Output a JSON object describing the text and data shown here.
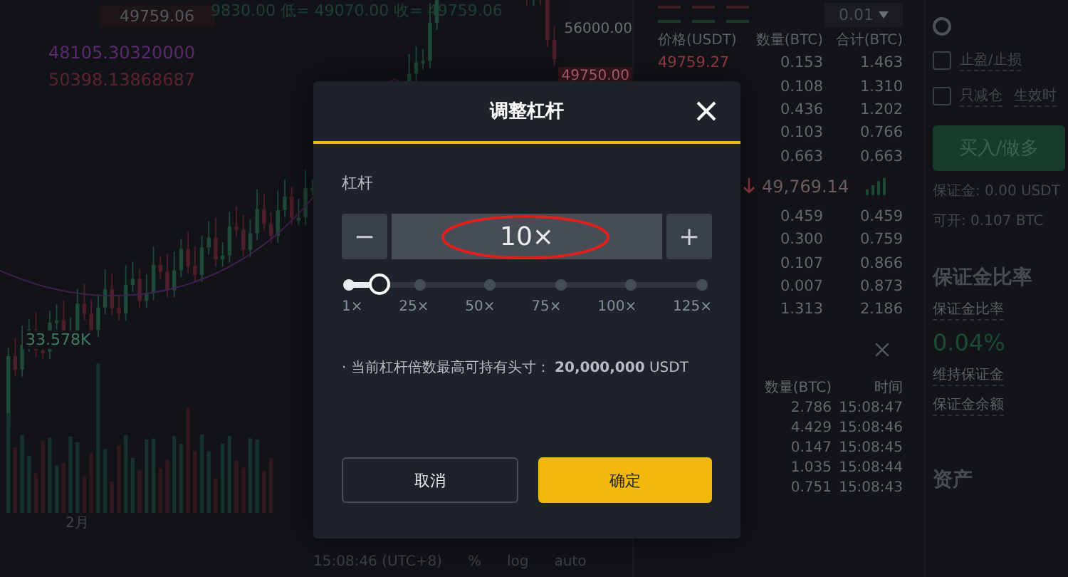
{
  "chart": {
    "ohlc_text": "9830.00 低= 49070.00 收= 49759.06",
    "last_price": "49759.06",
    "legend": [
      {
        "value": "48105.30320000",
        "color": "#5b2a6e"
      },
      {
        "value": "50398.13868687",
        "color": "#5e2232"
      }
    ],
    "price_ticks": [
      "56000.00"
    ],
    "price_tag": "49750.00",
    "volume_label": "33.578K",
    "month_label": "2月",
    "footer": [
      "15:08:46 (UTC+8)",
      "%",
      "log",
      "auto"
    ]
  },
  "order_book": {
    "precision": "0.01",
    "columns": [
      "价格(USDT)",
      "数量(BTC)",
      "合计(BTC)"
    ],
    "asks": [
      {
        "price": "49759.27",
        "amount": "0.153",
        "total": "1.463"
      },
      {
        "amount": "0.108",
        "total": "1.310"
      },
      {
        "amount": "0.436",
        "total": "1.202"
      },
      {
        "amount": "0.103",
        "total": "0.766"
      },
      {
        "amount": "0.663",
        "total": "0.663"
      }
    ],
    "mid_price": "49,769.14",
    "bids": [
      {
        "amount": "0.459",
        "total": "0.459"
      },
      {
        "amount": "0.300",
        "total": "0.759"
      },
      {
        "amount": "0.107",
        "total": "0.866"
      },
      {
        "amount": "0.007",
        "total": "0.873"
      },
      {
        "amount": "1.313",
        "total": "2.186"
      }
    ]
  },
  "trades": {
    "columns": [
      "数量(BTC)",
      "时间"
    ],
    "rows": [
      {
        "amount": "2.786",
        "time": "15:08:47"
      },
      {
        "amount": "4.429",
        "time": "15:08:46"
      },
      {
        "amount": "0.147",
        "time": "15:08:45"
      },
      {
        "amount": "1.035",
        "time": "15:08:44"
      },
      {
        "amount": "0.751",
        "time": "15:08:43"
      }
    ]
  },
  "order_panel": {
    "options": [
      {
        "label": "止盈/止损",
        "checked": false
      },
      {
        "label": "只减仓",
        "checked": false
      }
    ],
    "effective_label": "生效时",
    "buy_button": "买入/做多",
    "margin": "保证金: 0.00 USDT",
    "available": "可开: 0.107 BTC"
  },
  "margin_ratio": {
    "heading": "保证金比率",
    "label": "保证金比率",
    "value": "0.04%",
    "items": [
      "维持保证金",
      "保证金余额"
    ],
    "assets_heading": "资产"
  },
  "modal": {
    "title": "调整杠杆",
    "label": "杠杆",
    "minus": "−",
    "value": "10×",
    "plus": "+",
    "slider": {
      "level": 0.07,
      "marks": [
        "1×",
        "25×",
        "50×",
        "75×",
        "100×",
        "125×"
      ]
    },
    "info": "· 当前杠杆倍数最高可持有头寸： **20,000,000** USDT",
    "cancel": "取消",
    "confirm": "确定"
  }
}
